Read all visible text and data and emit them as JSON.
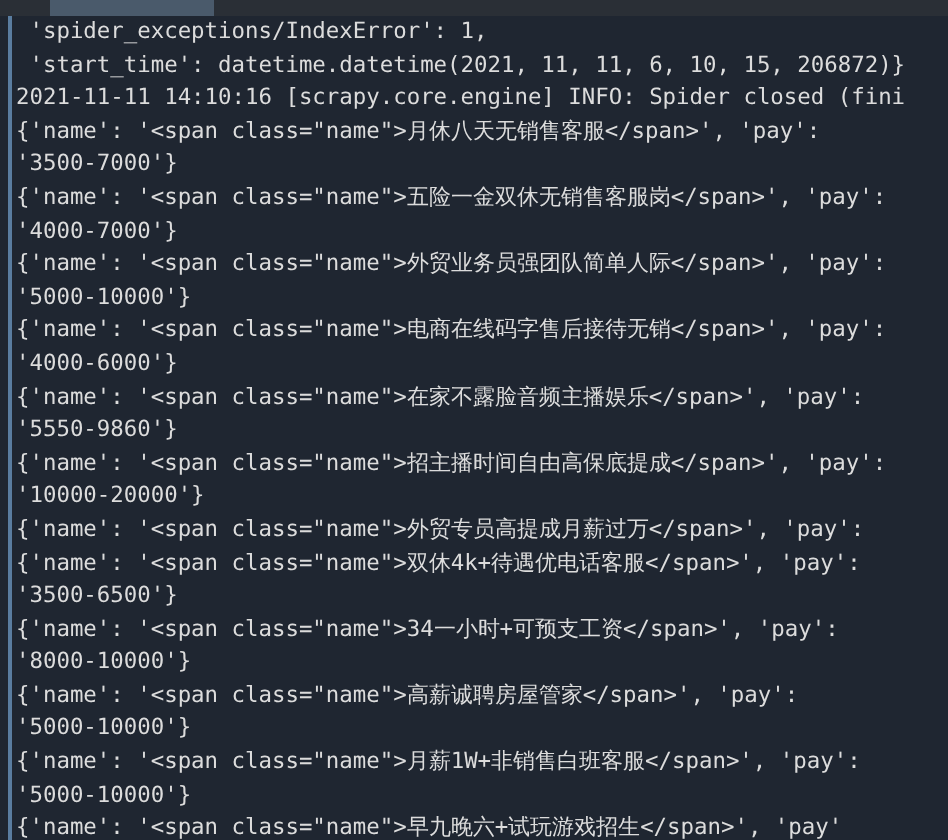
{
  "tab_bar": {
    "tabs": [
      {
        "selected": true
      }
    ]
  },
  "terminal": {
    "lines": [
      " 'spider_exceptions/IndexError': 1,",
      " 'start_time': datetime.datetime(2021, 11, 11, 6, 10, 15, 206872)}",
      "2021-11-11 14:10:16 [scrapy.core.engine] INFO: Spider closed (fini",
      "{'name': '<span class=\"name\">月休八天无销售客服</span>', 'pay':",
      "'3500-7000'}",
      "{'name': '<span class=\"name\">五险一金双休无销售客服岗</span>', 'pay':",
      "'4000-7000'}",
      "{'name': '<span class=\"name\">外贸业务员强团队简单人际</span>', 'pay':",
      "'5000-10000'}",
      "{'name': '<span class=\"name\">电商在线码字售后接待无销</span>', 'pay':",
      "'4000-6000'}",
      "{'name': '<span class=\"name\">在家不露脸音频主播娱乐</span>', 'pay':",
      "'5550-9860'}",
      "{'name': '<span class=\"name\">招主播时间自由高保底提成</span>', 'pay':",
      "'10000-20000'}",
      "{'name': '<span class=\"name\">外贸专员高提成月薪过万</span>', 'pay':",
      "{'name': '<span class=\"name\">双休4k+待遇优电话客服</span>', 'pay':",
      "'3500-6500'}",
      "{'name': '<span class=\"name\">34一小时+可预支工资</span>', 'pay':",
      "'8000-10000'}",
      "{'name': '<span class=\"name\">高薪诚聘房屋管家</span>', 'pay':",
      "'5000-10000'}",
      "{'name': '<span class=\"name\">月薪1W+非销售白班客服</span>', 'pay':",
      "'5000-10000'}",
      "{'name': '<span class=\"name\">早九晚六+试玩游戏招生</span>', 'pay'"
    ]
  }
}
